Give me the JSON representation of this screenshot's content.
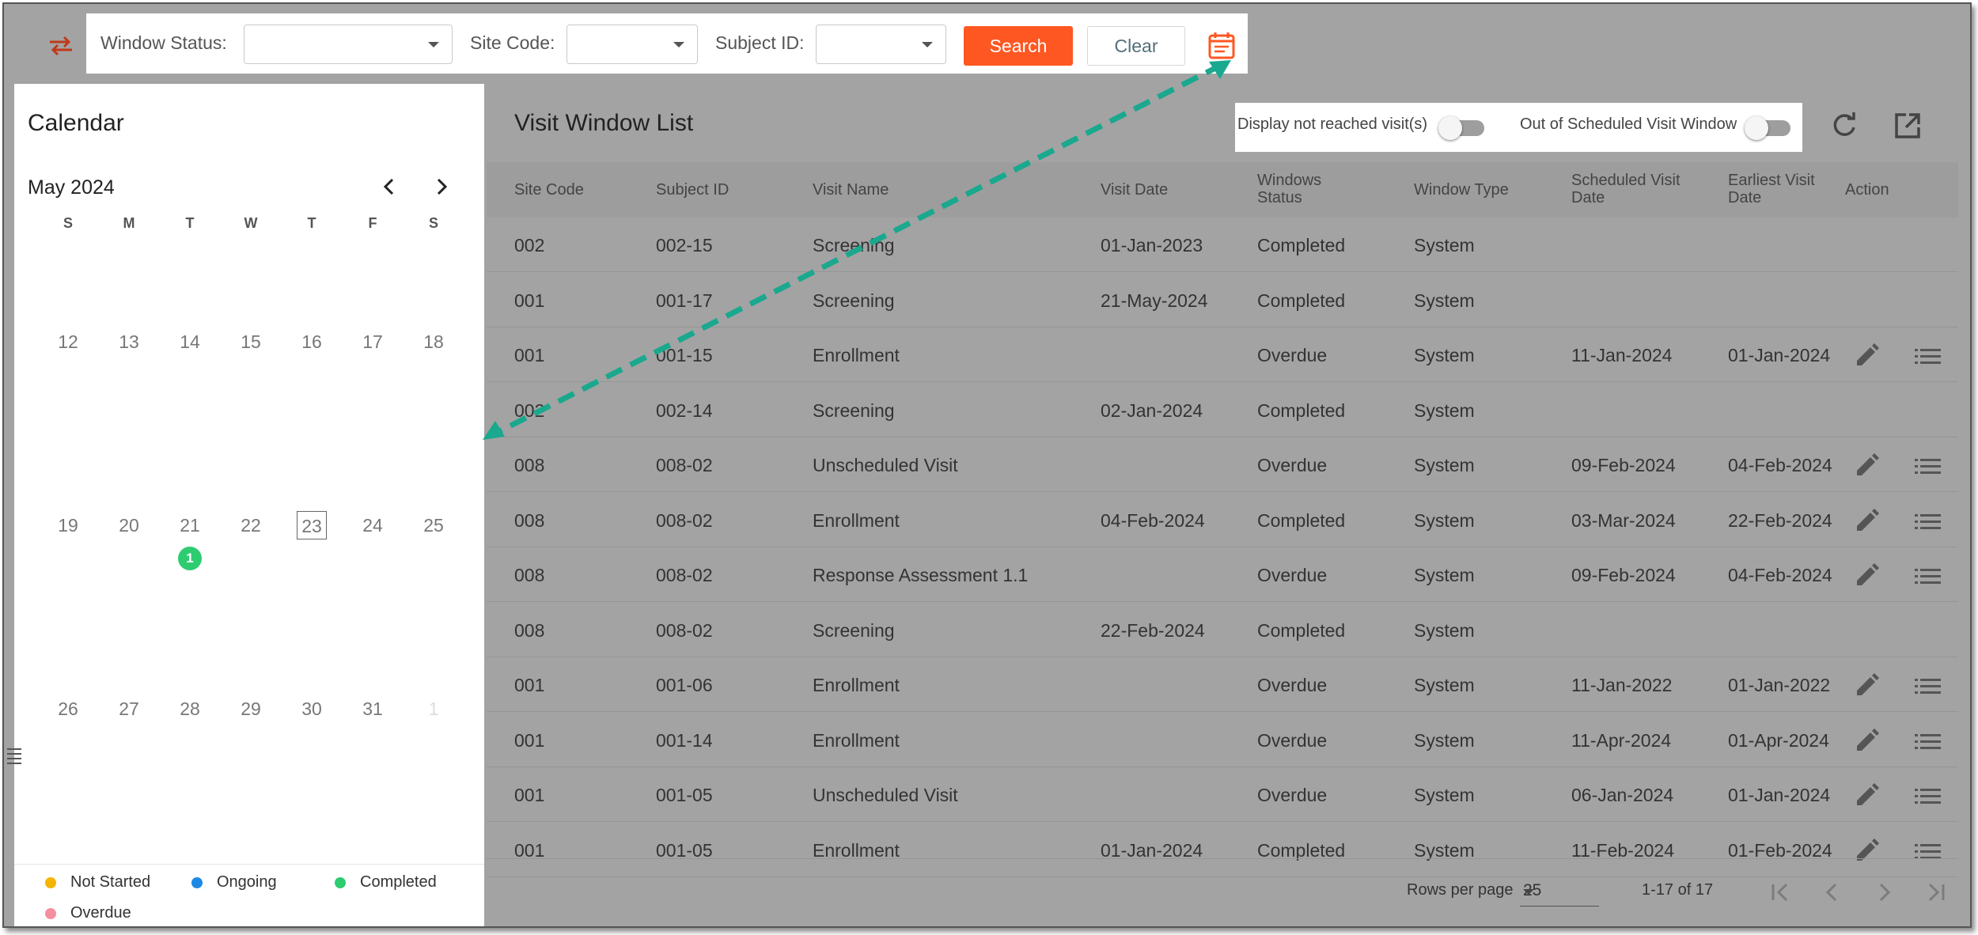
{
  "filters": {
    "window_status_label": "Window Status:",
    "window_status_value": "",
    "site_code_label": "Site Code:",
    "site_code_value": "",
    "subject_id_label": "Subject ID:",
    "subject_id_value": "",
    "search_label": "Search",
    "clear_label": "Clear"
  },
  "icons": {
    "swap": "swap-arrows-icon",
    "calendar_toggle": "calendar-icon",
    "refresh": "refresh-icon",
    "open_external": "open-in-new-icon",
    "edit": "pencil-icon",
    "details": "list-icon",
    "sidebar_handle": "list-icon"
  },
  "colors": {
    "accent": "#ff5722",
    "swap_icon": "#c0391b",
    "arrow": "#1aa88e",
    "today_badge": "#2ecc71",
    "not_started": "#f5b400",
    "ongoing": "#1e88e5",
    "completed": "#2ecc71",
    "overdue": "#f48fa0"
  },
  "calendar": {
    "title": "Calendar",
    "month": "May 2024",
    "weekdays": [
      "S",
      "M",
      "T",
      "W",
      "T",
      "F",
      "S"
    ],
    "weeks": [
      [
        "12",
        "13",
        "14",
        "15",
        "16",
        "17",
        "18"
      ],
      [
        "19",
        "20",
        "21",
        "22",
        "23",
        "24",
        "25"
      ],
      [
        "26",
        "27",
        "28",
        "29",
        "30",
        "31",
        "1"
      ]
    ],
    "selected_day": "23",
    "event_day": "21",
    "event_count": "1",
    "legend": {
      "not_started": "Not Started",
      "ongoing": "Ongoing",
      "completed": "Completed",
      "overdue": "Overdue"
    }
  },
  "grid": {
    "title": "Visit Window List",
    "toggle_not_reached": "Display not reached visit(s)",
    "toggle_out_of_window": "Out of Scheduled Visit Window",
    "columns": {
      "site_code": "Site Code",
      "subject_id": "Subject ID",
      "visit_name": "Visit Name",
      "visit_date": "Visit Date",
      "windows_status_1": "Windows",
      "windows_status_2": "Status",
      "window_type": "Window Type",
      "scheduled_1": "Scheduled Visit",
      "scheduled_2": "Date",
      "earliest_1": "Earliest Visit",
      "earliest_2": "Date",
      "action": "Action"
    },
    "rows": [
      {
        "site": "002",
        "subject": "002-15",
        "visit": "Screening",
        "visit_date": "01-Jan-2023",
        "status": "Completed",
        "type": "System",
        "scheduled": "",
        "earliest": ""
      },
      {
        "site": "001",
        "subject": "001-17",
        "visit": "Screening",
        "visit_date": "21-May-2024",
        "status": "Completed",
        "type": "System",
        "scheduled": "",
        "earliest": ""
      },
      {
        "site": "001",
        "subject": "001-15",
        "visit": "Enrollment",
        "visit_date": "",
        "status": "Overdue",
        "type": "System",
        "scheduled": "11-Jan-2024",
        "earliest": "01-Jan-2024"
      },
      {
        "site": "002",
        "subject": "002-14",
        "visit": "Screening",
        "visit_date": "02-Jan-2024",
        "status": "Completed",
        "type": "System",
        "scheduled": "",
        "earliest": ""
      },
      {
        "site": "008",
        "subject": "008-02",
        "visit": "Unscheduled Visit",
        "visit_date": "",
        "status": "Overdue",
        "type": "System",
        "scheduled": "09-Feb-2024",
        "earliest": "04-Feb-2024"
      },
      {
        "site": "008",
        "subject": "008-02",
        "visit": "Enrollment",
        "visit_date": "04-Feb-2024",
        "status": "Completed",
        "type": "System",
        "scheduled": "03-Mar-2024",
        "earliest": "22-Feb-2024"
      },
      {
        "site": "008",
        "subject": "008-02",
        "visit": "Response Assessment 1.1",
        "visit_date": "",
        "status": "Overdue",
        "type": "System",
        "scheduled": "09-Feb-2024",
        "earliest": "04-Feb-2024"
      },
      {
        "site": "008",
        "subject": "008-02",
        "visit": "Screening",
        "visit_date": "22-Feb-2024",
        "status": "Completed",
        "type": "System",
        "scheduled": "",
        "earliest": ""
      },
      {
        "site": "001",
        "subject": "001-06",
        "visit": "Enrollment",
        "visit_date": "",
        "status": "Overdue",
        "type": "System",
        "scheduled": "11-Jan-2022",
        "earliest": "01-Jan-2022"
      },
      {
        "site": "001",
        "subject": "001-14",
        "visit": "Enrollment",
        "visit_date": "",
        "status": "Overdue",
        "type": "System",
        "scheduled": "11-Apr-2024",
        "earliest": "01-Apr-2024"
      },
      {
        "site": "001",
        "subject": "001-05",
        "visit": "Unscheduled Visit",
        "visit_date": "",
        "status": "Overdue",
        "type": "System",
        "scheduled": "06-Jan-2024",
        "earliest": "01-Jan-2024"
      },
      {
        "site": "001",
        "subject": "001-05",
        "visit": "Enrollment",
        "visit_date": "01-Jan-2024",
        "status": "Completed",
        "type": "System",
        "scheduled": "11-Feb-2024",
        "earliest": "01-Feb-2024"
      }
    ],
    "rows_per_page_label": "Rows per page",
    "rows_per_page_value": "25",
    "range_text": "1-17 of 17"
  }
}
